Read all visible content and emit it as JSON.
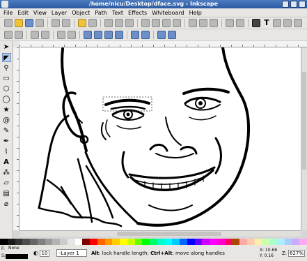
{
  "window": {
    "title": "/home/nicu/Desktop/dface.svg - Inkscape"
  },
  "menu": [
    "File",
    "Edit",
    "View",
    "Layer",
    "Object",
    "Path",
    "Text",
    "Effects",
    "Whiteboard",
    "Help"
  ],
  "status": {
    "fill_label": "F:",
    "stroke_label": "S:",
    "fill_value": "None",
    "opacity_value": "10",
    "layer": "-Layer 1",
    "message_bold1": "Alt",
    "message_1": ": lock handle length; ",
    "message_bold2": "Ctrl+Alt",
    "message_2": ": move along handles",
    "x_coord": "X: 10.68",
    "y_coord": "Y: 0.16",
    "zoom_label": "Z:",
    "zoom_value": "627%"
  },
  "colors": {
    "palette": [
      "#000000",
      "#1a1a1a",
      "#333333",
      "#4d4d4d",
      "#666666",
      "#808080",
      "#999999",
      "#b3b3b3",
      "#cccccc",
      "#e6e6e6",
      "#ffffff",
      "#800000",
      "#ff0000",
      "#ff6600",
      "#ff9900",
      "#ffcc00",
      "#ffff00",
      "#ccff00",
      "#66ff00",
      "#00ff00",
      "#00ff66",
      "#00ffcc",
      "#00ffff",
      "#00ccff",
      "#0066ff",
      "#0000ff",
      "#6600ff",
      "#cc00ff",
      "#ff00ff",
      "#ff00cc",
      "#ff0066",
      "#aa4400",
      "#ffaaaa",
      "#ffccaa",
      "#ffeeaa",
      "#ccffaa",
      "#aaffcc",
      "#aaeeff",
      "#aaccff",
      "#ccaaff",
      "#ffaaee"
    ]
  }
}
